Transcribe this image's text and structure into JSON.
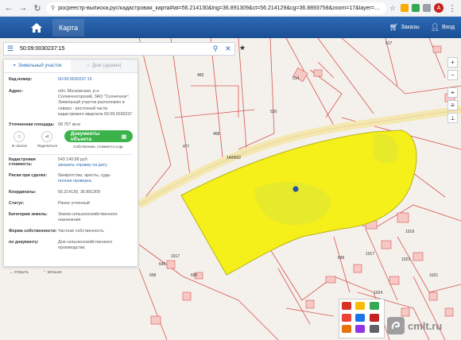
{
  "browser": {
    "url": "росреестр-выписка.рус/кадастровая_карта#lat=56.214130&lng=36.891309&ct=56.214129&cg=36.8893758&zoom=17&layer=ya&zouit=f..."
  },
  "header": {
    "title": "Карта",
    "orders_label": "Заказы",
    "login_label": "Вход"
  },
  "search": {
    "value": "50:09:0030237:15"
  },
  "panel": {
    "tab_land": "Земельный участок",
    "tab_house": "Дом (здание)",
    "fields": [
      {
        "label": "Кад.номер:",
        "value": "50:09:0030237:15",
        "link": true
      },
      {
        "label": "Адрес:",
        "value": "обл. Московская, р-н Солнечногорский, ЗАО \"Солнечное\", Земельный участок расположен в северо - восточной части кадастрового квартала 50:09:0030237",
        "link": false
      },
      {
        "label": "Уточненная площадь:",
        "value": "58 757 кв.м",
        "link": false
      }
    ],
    "actions": {
      "list_label": "В список",
      "share_label": "Поделиться",
      "docs_label": "Документы объекта",
      "docs_sub": "Собственник, стоимость и др."
    },
    "value_label": "Кадастровая стоимость:",
    "value_amount": "543 140.88 руб.",
    "value_link": "заказать справку на дату",
    "risk_label": "Риски при сделке:",
    "risk_value": "банкротства, аресты, суды",
    "risk_link": "полная проверка",
    "coords_label": "Координаты:",
    "coords_value": "56.214130, 36.891309",
    "status_label": "Статус:",
    "status_value": "Ранее учтенный",
    "category_label": "Категория земель:",
    "category_value": "Земли сельскохозяйственного назначения",
    "ownership_label": "Форма собственности:",
    "ownership_value": "Частная собственность",
    "doc_label": "по документу:",
    "doc_value": "Для сельскохозяйственного производства"
  },
  "expand": {
    "more": "открыть",
    "less": "меньше"
  },
  "map": {
    "parcel_id": "14090/2",
    "labels": [
      "483",
      "477",
      "468",
      "517",
      "514",
      "520",
      "1017",
      "1019",
      "1023",
      "1021",
      "696",
      "1024",
      "1017",
      "658",
      "645",
      "655"
    ]
  },
  "watermark": {
    "text": "cmlt.ru"
  },
  "colors": {
    "header": "#1b4f93",
    "parcel_fill": "#f5f01a",
    "docs_button": "#3cb34a",
    "link": "#2d69b5",
    "boundary": "#d9534f"
  }
}
